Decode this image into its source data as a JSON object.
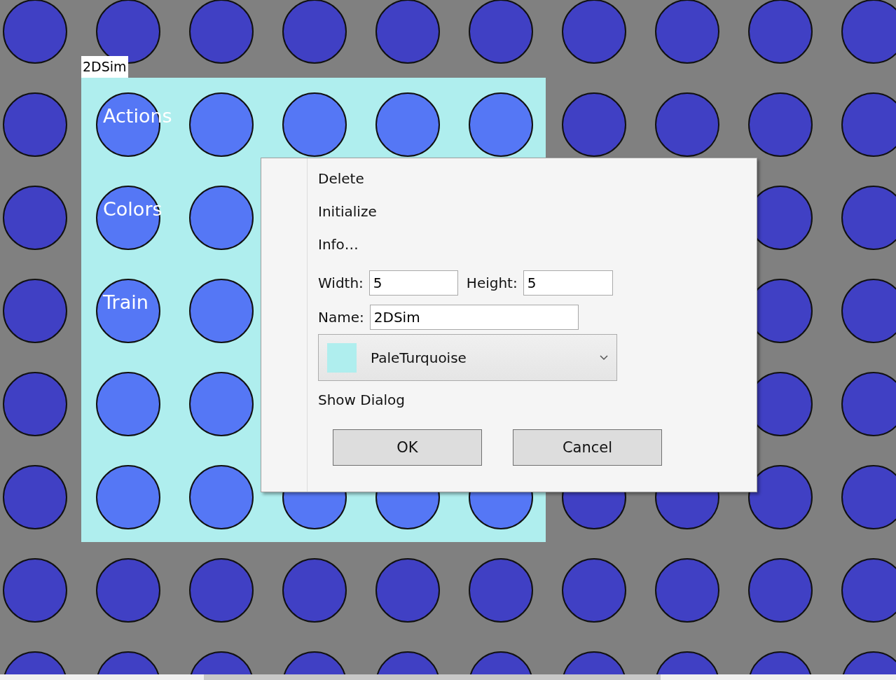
{
  "window": {
    "title": "2DSim"
  },
  "panel_labels": [
    "Actions",
    "Colors",
    "Train"
  ],
  "context_menu": {
    "items": [
      "Delete",
      "Initialize",
      "Info…"
    ],
    "width": {
      "label": "Width:",
      "value": "5"
    },
    "height": {
      "label": "Height:",
      "value": "5"
    },
    "name": {
      "label": "Name:",
      "value": "2DSim"
    },
    "color_select": {
      "value": "PaleTurquoise"
    },
    "show_dialog": "Show Dialog",
    "buttons": [
      "OK",
      "Cancel"
    ]
  }
}
